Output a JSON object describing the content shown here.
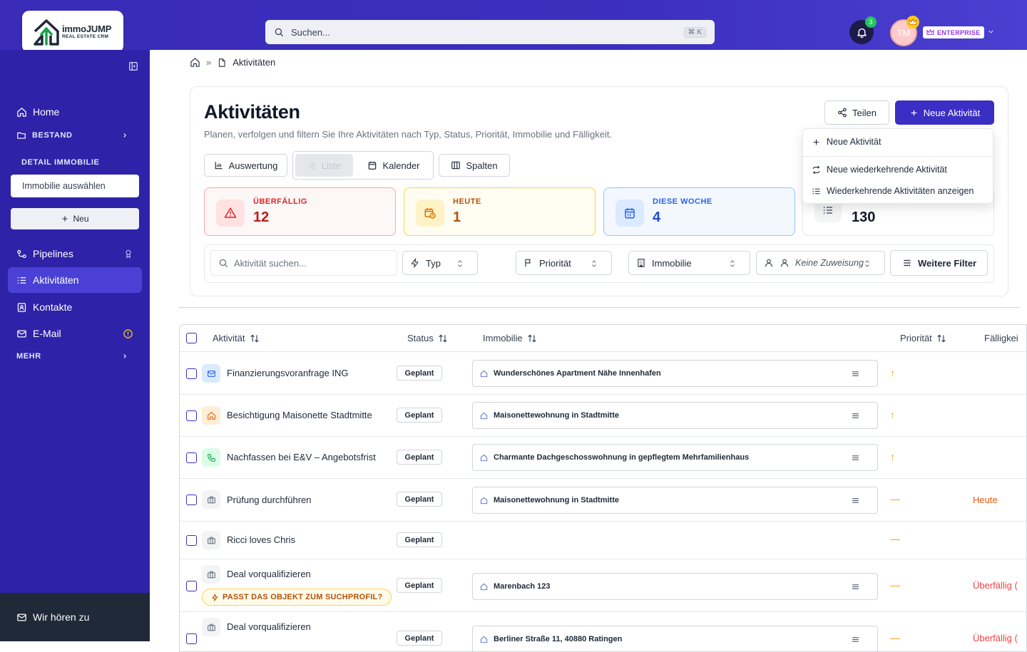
{
  "app": {
    "logo_name": "immoJUMP",
    "logo_tag": "REAL ESTATE CRM",
    "search_placeholder": "Suchen...",
    "search_shortcut": "⌘ K",
    "notifications_count": "3",
    "user_initials": "TM",
    "plan_badge": "ENTERPRISE",
    "colors": {
      "brand": "#3b2ec4",
      "sidebar": "#2e22a8",
      "overdue": "#dc2626",
      "today": "#d97706",
      "week": "#2563eb"
    }
  },
  "sidebar": {
    "home": "Home",
    "bestand": "BESTAND",
    "detail_section": "DETAIL IMMOBILIE",
    "property_select": "Immobilie auswählen",
    "new_button": "Neu",
    "pipelines": "Pipelines",
    "activities": "Aktivitäten",
    "contacts": "Kontakte",
    "email": "E-Mail",
    "more": "MEHR",
    "feedback": "Wir hören zu"
  },
  "breadcrumb": {
    "current": "Aktivitäten"
  },
  "page": {
    "title": "Aktivitäten",
    "subtitle": "Planen, verfolgen und filtern Sie Ihre Aktivitäten nach Typ, Status, Priorität, Immobilie und Fälligkeit.",
    "share_button": "Teilen",
    "new_activity_button": "Neue Aktivität",
    "dropdown": {
      "new_activity": "Neue Aktivität",
      "new_recurring": "Neue wiederkehrende Aktivität",
      "show_recurring": "Wiederkehrende Aktivitäten anzeigen"
    },
    "view_buttons": {
      "evaluation": "Auswertung",
      "list": "Liste",
      "calendar": "Kalender",
      "columns": "Spalten"
    }
  },
  "stats": {
    "overdue": {
      "label": "ÜBERFÄLLIG",
      "value": "12"
    },
    "today": {
      "label": "HEUTE",
      "value": "1"
    },
    "week": {
      "label": "DIESE WOCHE",
      "value": "4"
    },
    "total": {
      "value": "130"
    }
  },
  "filters": {
    "search_placeholder": "Aktivität suchen...",
    "type": "Typ",
    "priority": "Priorität",
    "property": "Immobilie",
    "assignee": "Keine Zuweisung",
    "more": "Weitere Filter"
  },
  "table": {
    "columns": {
      "activity": "Aktivität",
      "status": "Status",
      "property": "Immobilie",
      "priority": "Priorität",
      "due": "Fälligkei"
    },
    "rows": [
      {
        "name": "Finanzierungsvoranfrage ING",
        "status": "Geplant",
        "property": "Wunderschönes Apartment Nähe Innenhafen",
        "priority": "↑",
        "due": ""
      },
      {
        "name": "Besichtigung Maisonette Stadtmitte",
        "status": "Geplant",
        "property": "Maisonettewohnung in Stadtmitte",
        "priority": "↑",
        "due": ""
      },
      {
        "name": "Nachfassen bei E&V – Angebotsfrist",
        "status": "Geplant",
        "property": "Charmante Dachgeschosswohnung in gepflegtem Mehrfamilienhaus",
        "priority": "↑",
        "due": ""
      },
      {
        "name": "Prüfung durchführen",
        "status": "Geplant",
        "property": "Maisonettewohnung in Stadtmitte",
        "priority": "—",
        "due": "Heute"
      },
      {
        "name": "Ricci loves Chris",
        "status": "Geplant",
        "property": "",
        "priority": "—",
        "due": ""
      },
      {
        "name": "Deal vorqualifizieren",
        "status": "Geplant",
        "property": "Marenbach 123",
        "priority": "—",
        "due": "Überfällig (",
        "tag": "PASST DAS OBJEKT ZUM SUCHPROFIL?"
      },
      {
        "name": "Deal vorqualifizieren",
        "status": "Geplant",
        "property": "Berliner Straße 11, 40880 Ratingen",
        "priority": "—",
        "due": "Überfällig ("
      }
    ]
  }
}
